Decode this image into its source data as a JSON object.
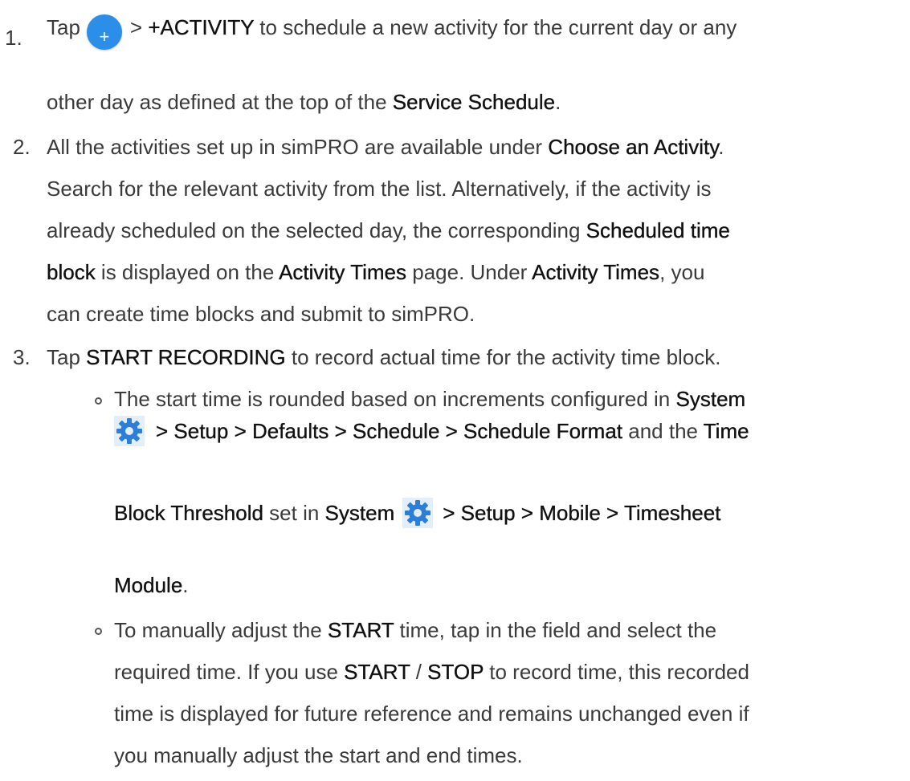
{
  "items": [
    {
      "num": "1.",
      "line1": {
        "t1": "Tap",
        "plus": "+",
        "t2": "> ",
        "b1": "+ACTIVITY",
        "t3": " to schedule a new activity for the current day or any"
      },
      "line2": {
        "t1": "other day as defined at the top of the ",
        "b1": "Service Schedule",
        "t2": "."
      }
    },
    {
      "num": "2.",
      "line1": {
        "t1": "All the activities set up in simPRO are available under ",
        "b1": "Choose an Activity",
        "t2": "."
      },
      "line2": "Search for the relevant activity from the list. Alternatively, if the activity is",
      "line3": {
        "t1": "already scheduled on the selected day, the corresponding ",
        "b1": "Scheduled time"
      },
      "line4": {
        "b1": "block",
        "t1": " is displayed on the ",
        "b2": "Activity Times",
        "t2": " page. Under ",
        "b3": "Activity Times",
        "t3": ", you"
      },
      "line5": "can create time blocks and submit to simPRO."
    },
    {
      "num": "3.",
      "line1": {
        "t1": "Tap ",
        "b1": "START RECORDING",
        "t2": " to record actual time for the activity time block."
      },
      "bullets": [
        {
          "line1": {
            "t1": "The start time is rounded based on increments configured in ",
            "b1": "System"
          },
          "line2": {
            "b1": "> Setup > Defaults > Schedule > Schedule Format",
            "t1": " and the ",
            "b2": "Time"
          },
          "line3": {
            "b1": "Block Threshold",
            "t1": " set in ",
            "b2": "System",
            "b3": "> Setup > Mobile > Timesheet"
          },
          "line4": {
            "b1": "Module",
            "t1": "."
          }
        },
        {
          "line1": {
            "t1": "To manually adjust the ",
            "b1": "START",
            "t2": " time, tap in the field and select the"
          },
          "line2": {
            "t1": "required time. If you use ",
            "b1": "START",
            "t2": " / ",
            "b2": "STOP",
            "t3": " to record time, this recorded"
          },
          "line3": "time is displayed for future reference and remains unchanged even if",
          "line4": "you manually adjust the start and end times."
        }
      ]
    }
  ],
  "colors": {
    "plus_button": "#2b8ee8",
    "gear_icon": "#2b7fd8",
    "text": "#3a3a3a",
    "bold_text": "#111111"
  }
}
